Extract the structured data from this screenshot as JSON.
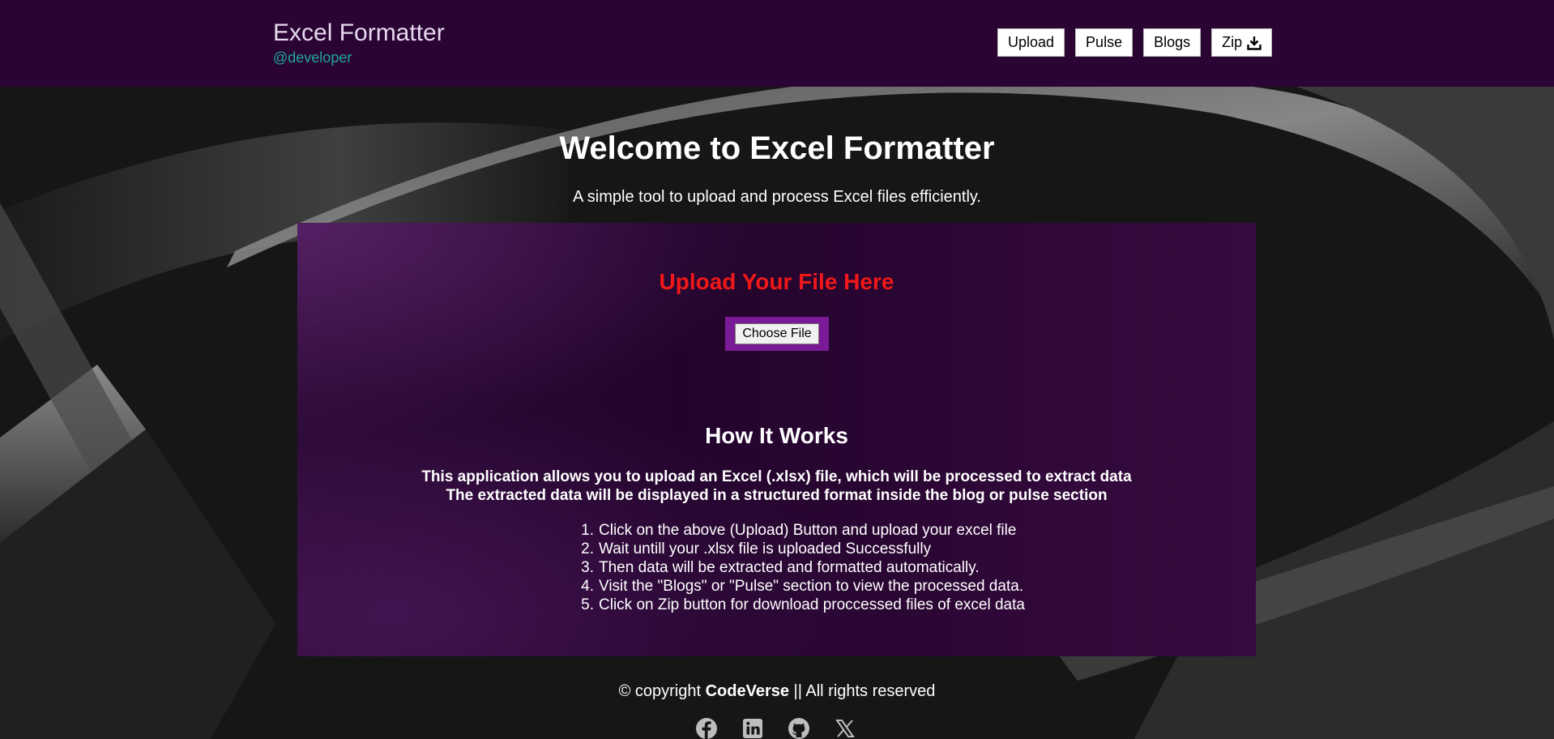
{
  "header": {
    "title": "Excel Formatter",
    "handle": "@developer",
    "nav": [
      {
        "label": "Upload"
      },
      {
        "label": "Pulse"
      },
      {
        "label": "Blogs"
      },
      {
        "label": "Zip",
        "icon": "download-icon"
      }
    ]
  },
  "main": {
    "welcome": "Welcome to Excel Formatter",
    "subtitle": "A simple tool to upload and process Excel files efficiently.",
    "upload_heading": "Upload Your File Here",
    "choose_file_label": "Choose File",
    "how_heading": "How It Works",
    "description": [
      "This application allows you to upload an Excel (.xlsx) file, which will be processed to extract data",
      "The extracted data will be displayed in a structured format inside the blog or pulse section"
    ],
    "steps": [
      {
        "num": "1.",
        "text": "Click on the above (Upload) Button and upload your excel file"
      },
      {
        "num": "2.",
        "text": "Wait untill your .xlsx file is uploaded Successfully"
      },
      {
        "num": "3.",
        "text": "Then data will be extracted and formatted automatically."
      },
      {
        "num": "4.",
        "text": "Visit the \"Blogs\" or \"Pulse\" section to view the processed data."
      },
      {
        "num": "5.",
        "text": "Click on Zip button for download proccessed files of excel data"
      }
    ]
  },
  "footer": {
    "copyright_prefix": "© copyright ",
    "brand": "CodeVerse",
    "copyright_suffix": " || All rights reserved",
    "socials": [
      "facebook-icon",
      "linkedin-icon",
      "github-icon",
      "x-icon"
    ]
  },
  "colors": {
    "header_bg": "#2a0533",
    "handle": "#20a5a0",
    "upload_heading": "#f01818",
    "file_wrap": "#7a1a96"
  }
}
